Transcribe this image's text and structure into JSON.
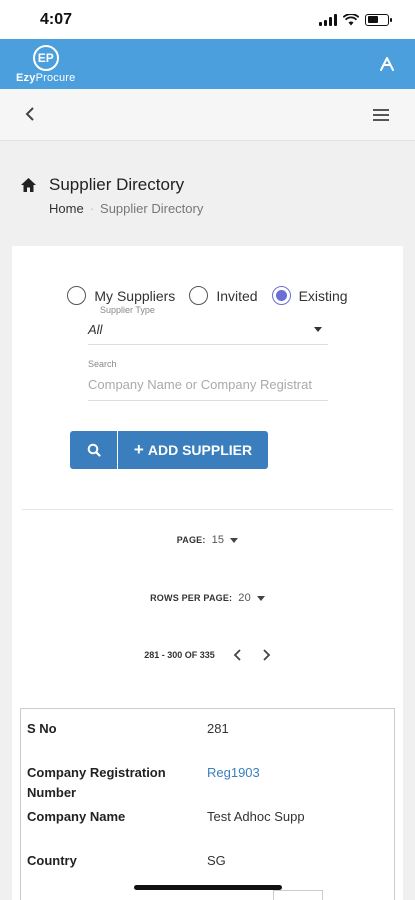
{
  "status": {
    "time": "4:07"
  },
  "header": {
    "logo_mark": "EP",
    "logo_text_bold": "Ezy",
    "logo_text": "Procure"
  },
  "page": {
    "title": "Supplier Directory",
    "breadcrumb": {
      "home": "Home",
      "current": "Supplier Directory"
    }
  },
  "filters": {
    "radios": [
      {
        "label": "My Suppliers",
        "checked": false
      },
      {
        "label": "Invited",
        "checked": false
      },
      {
        "label": "Existing",
        "checked": true
      }
    ],
    "supplier_type_label": "Supplier Type",
    "supplier_type_value": "All",
    "search_label": "Search",
    "search_placeholder": "Company Name or Company Registrat",
    "add_button_label": "ADD SUPPLIER"
  },
  "pagination": {
    "page_label": "PAGE:",
    "page_value": "15",
    "rows_label": "ROWS PER PAGE:",
    "rows_value": "20",
    "range_text": "281 - 300 OF 335"
  },
  "record": {
    "sno_label": "S No",
    "sno_value": "281",
    "reg_label_1": "Company Registration",
    "reg_label_2": "Number",
    "reg_value": "Reg1903",
    "name_label": "Company Name",
    "name_value": "Test Adhoc Supp",
    "country_label": "Country",
    "country_value": "SG"
  },
  "colors": {
    "header_blue": "#4a9fdc",
    "button_blue": "#3a7ebd",
    "radio_accent": "#6a6fd6"
  }
}
